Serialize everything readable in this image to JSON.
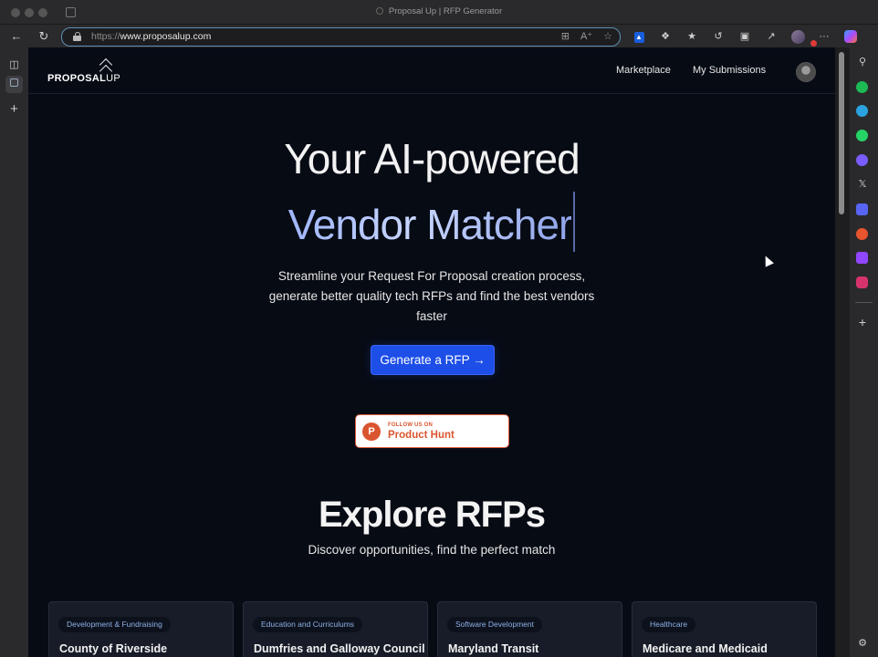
{
  "window": {
    "title": "Proposal Up | RFP Generator"
  },
  "browser": {
    "url_scheme": "https://",
    "url_host": "www.proposalup.com",
    "icons": [
      "back-icon",
      "reload-icon",
      "lock-icon",
      "apps-icon",
      "read-aloud-icon",
      "favorite-star-icon",
      "bitwarden-icon",
      "extensions-icon",
      "favorites-icon",
      "history-icon",
      "screenshot-icon",
      "share-icon",
      "profile-icon",
      "more-icon",
      "copilot-icon"
    ],
    "more_label": "···"
  },
  "right_sidebar": {
    "icons": [
      "search-icon",
      "spotify-icon",
      "telegram-icon",
      "whatsapp-icon",
      "messenger-icon",
      "x-icon",
      "discord-icon",
      "brave-icon",
      "twitch-icon",
      "instagram-icon",
      "add-icon",
      "settings-icon"
    ],
    "colors": {
      "spotify": "#1db954",
      "telegram": "#2aa3e0",
      "whatsapp": "#25d366",
      "messenger": "#7b5cff",
      "discord": "#5865f2",
      "brave": "#e8542e",
      "twitch": "#9146ff",
      "instagram": "#d6336c"
    }
  },
  "site": {
    "logo": {
      "bold": "PROPOSAL",
      "light": "UP"
    },
    "nav": {
      "marketplace": "Marketplace",
      "my_submissions": "My Submissions"
    },
    "hero": {
      "line1": "Your AI-powered",
      "line2": "Vendor Matcher",
      "subtitle": "Streamline your Request For Proposal creation process, generate better quality tech RFPs and find the best vendors faster",
      "cta": "Generate a RFP →"
    },
    "product_hunt": {
      "logo_letter": "P",
      "small": "FOLLOW US ON",
      "big": "Product Hunt"
    },
    "explore": {
      "title": "Explore RFPs",
      "subtitle": "Discover opportunities, find the perfect match"
    },
    "cards": [
      {
        "tag": "Development & Fundraising",
        "title": "County of Riverside"
      },
      {
        "tag": "Education and Curriculums",
        "title": "Dumfries and Galloway Council"
      },
      {
        "tag": "Software Development",
        "title": "Maryland Transit"
      },
      {
        "tag": "Healthcare",
        "title": "Medicare and Medicaid"
      }
    ],
    "colors": {
      "background": "#070b14",
      "accent": "#1d4ee8",
      "card": "#171c28",
      "product_hunt": "#da552f"
    }
  }
}
